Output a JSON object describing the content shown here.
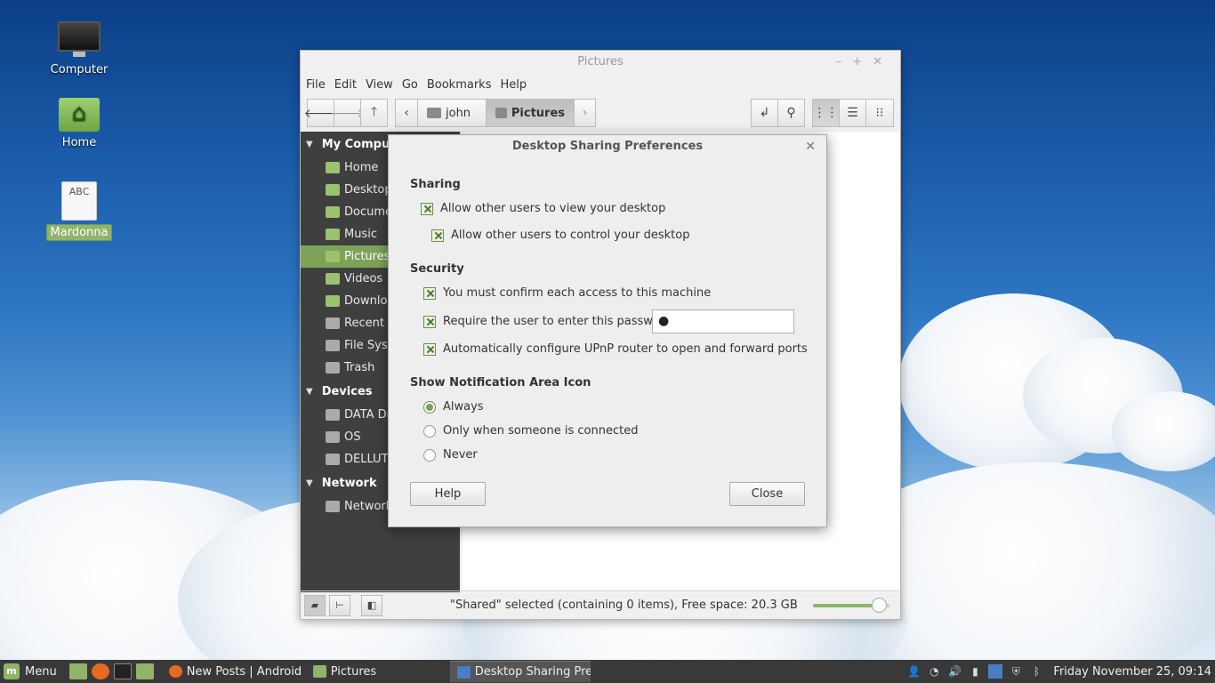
{
  "desktop": {
    "icons": [
      {
        "label": "Computer",
        "icon": "monitor-icon"
      },
      {
        "label": "Home",
        "icon": "home-folder-icon"
      },
      {
        "label": "Mardonna",
        "icon": "document-icon",
        "doc_text": "ABC"
      }
    ]
  },
  "file_manager": {
    "title": "Pictures",
    "menu": [
      "File",
      "Edit",
      "View",
      "Go",
      "Bookmarks",
      "Help"
    ],
    "breadcrumbs": [
      "john",
      "Pictures"
    ],
    "sidebar": {
      "sections": [
        {
          "title": "My Computer",
          "items": [
            "Home",
            "Desktop",
            "Documents",
            "Music",
            "Pictures",
            "Videos",
            "Downloads",
            "Recent",
            "File System",
            "Trash"
          ]
        },
        {
          "title": "Devices",
          "items": [
            "DATA Drive",
            "OS",
            "DELLUTILITY"
          ]
        },
        {
          "title": "Network",
          "items": [
            "Network"
          ]
        }
      ],
      "selected": "Pictures"
    },
    "status": "\"Shared\" selected (containing 0 items), Free space: 20.3 GB",
    "zoom_level": 0.87
  },
  "dialog": {
    "title": "Desktop Sharing Preferences",
    "sharing": {
      "heading": "Sharing",
      "allow_view": "Allow other users to view your desktop",
      "allow_control": "Allow other users to control your desktop"
    },
    "security": {
      "heading": "Security",
      "confirm": "You must confirm each access to this machine",
      "require_password": "Require the user to enter this password:",
      "password_value": "●",
      "upnp": "Automatically configure UPnP router to open and forward ports"
    },
    "notification": {
      "heading": "Show Notification Area Icon",
      "options": [
        "Always",
        "Only when someone is connected",
        "Never"
      ],
      "selected": "Always"
    },
    "help_label": "Help",
    "close_label": "Close"
  },
  "panel": {
    "menu_label": "Menu",
    "tasks": [
      "New Posts | Android...",
      "Pictures",
      "Desktop Sharing Pre..."
    ],
    "clock": "Friday November 25, 09:14"
  },
  "colors": {
    "accent": "#8fb46a",
    "sidebar": "#3f3f3f",
    "panel": "#393939"
  }
}
